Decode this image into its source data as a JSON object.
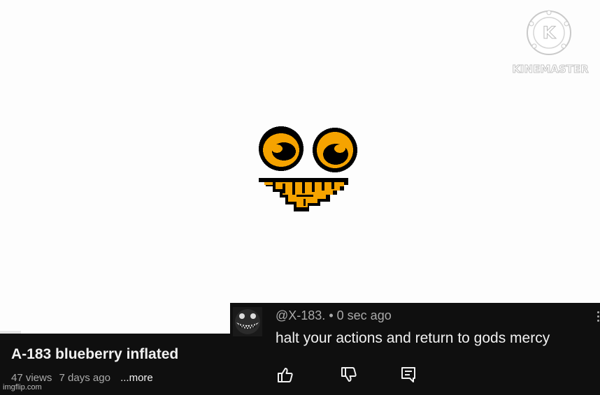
{
  "watermark": {
    "brand": "KINEMASTER",
    "icon": "kinemaster-logo-icon"
  },
  "video": {
    "title": "A-183 blueberry inflated",
    "views": "47 views",
    "age": "7 days ago",
    "more_label": "...more",
    "progress_fraction": 0.035
  },
  "comment": {
    "handle": "@X-183.",
    "separator": "•",
    "time": "0 sec ago",
    "text": "halt your actions and return to gods mercy",
    "actions": [
      "thumbs-up-icon",
      "thumbs-down-icon",
      "reply-icon"
    ]
  },
  "footer": {
    "site": "imgflip.com"
  },
  "colors": {
    "bg_dark": "#0f0f0f",
    "face_orange": "#f5a300",
    "text_primary": "#f1f1f1",
    "text_secondary": "#aaaaaa"
  }
}
